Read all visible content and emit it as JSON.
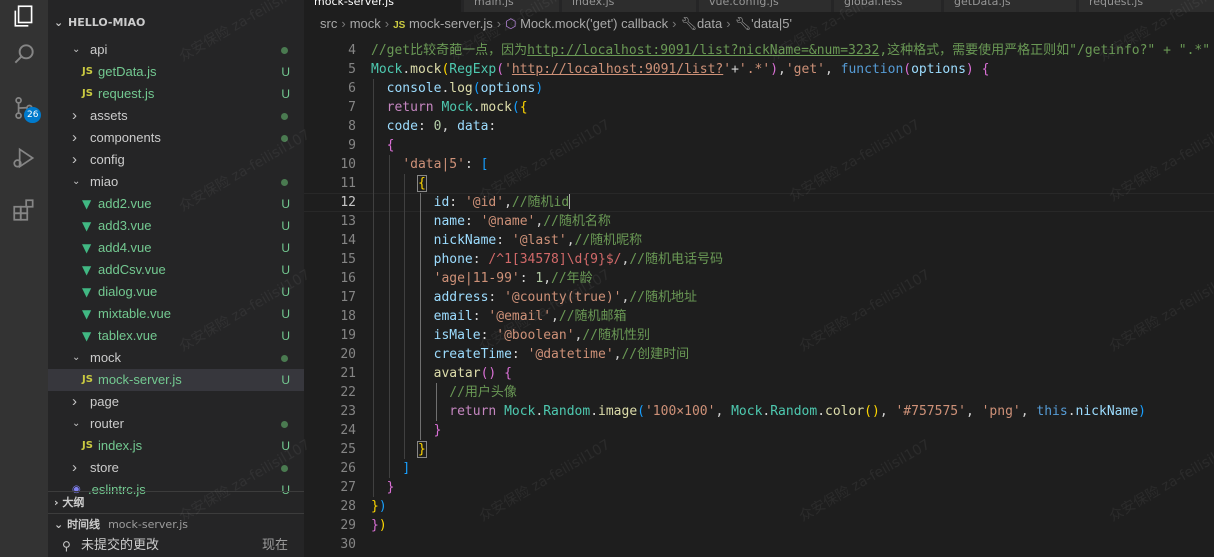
{
  "activity_bar": {
    "items": [
      {
        "icon": "explorer-icon"
      },
      {
        "icon": "search-icon"
      },
      {
        "icon": "source-control-icon",
        "badge": "26"
      },
      {
        "icon": "run-debug-icon"
      },
      {
        "icon": "extensions-icon"
      }
    ]
  },
  "explorer": {
    "title": "HELLO-MIAO",
    "tree": [
      {
        "label": "api",
        "type": "folder",
        "open": true,
        "depth": 1,
        "status": "dot"
      },
      {
        "label": "getData.js",
        "type": "js",
        "depth": 2,
        "status": "U"
      },
      {
        "label": "request.js",
        "type": "js",
        "depth": 2,
        "status": "U"
      },
      {
        "label": "assets",
        "type": "folder",
        "open": false,
        "depth": 1,
        "status": "dot"
      },
      {
        "label": "components",
        "type": "folder",
        "open": false,
        "depth": 1,
        "status": "dot"
      },
      {
        "label": "config",
        "type": "folder",
        "open": false,
        "depth": 1,
        "status": ""
      },
      {
        "label": "miao",
        "type": "folder",
        "open": true,
        "depth": 1,
        "status": "dot"
      },
      {
        "label": "add2.vue",
        "type": "vue",
        "depth": 2,
        "status": "U"
      },
      {
        "label": "add3.vue",
        "type": "vue",
        "depth": 2,
        "status": "U"
      },
      {
        "label": "add4.vue",
        "type": "vue",
        "depth": 2,
        "status": "U"
      },
      {
        "label": "addCsv.vue",
        "type": "vue",
        "depth": 2,
        "status": "U"
      },
      {
        "label": "dialog.vue",
        "type": "vue",
        "depth": 2,
        "status": "U"
      },
      {
        "label": "mixtable.vue",
        "type": "vue",
        "depth": 2,
        "status": "U"
      },
      {
        "label": "tablex.vue",
        "type": "vue",
        "depth": 2,
        "status": "U"
      },
      {
        "label": "mock",
        "type": "folder",
        "open": true,
        "depth": 1,
        "status": "dot"
      },
      {
        "label": "mock-server.js",
        "type": "js",
        "depth": 2,
        "status": "U",
        "selected": true
      },
      {
        "label": "page",
        "type": "folder",
        "open": false,
        "depth": 1,
        "status": ""
      },
      {
        "label": "router",
        "type": "folder",
        "open": true,
        "depth": 1,
        "status": "dot"
      },
      {
        "label": "index.js",
        "type": "js",
        "depth": 2,
        "status": "U"
      },
      {
        "label": "store",
        "type": "folder",
        "open": false,
        "depth": 1,
        "status": "dot"
      },
      {
        "label": ".eslintrc.js",
        "type": "eslint",
        "depth": 1,
        "status": "U"
      }
    ],
    "outline_title": "大纲",
    "timeline_title": "时间线",
    "timeline_file": "mock-server.js",
    "timeline_item": "未提交的更改",
    "timeline_time": "现在"
  },
  "tabs": [
    {
      "label": "mock-server.js",
      "active": true
    },
    {
      "label": "main.js",
      "active": false
    },
    {
      "label": "index.js",
      "active": false
    },
    {
      "label": "vue.config.js",
      "active": false
    },
    {
      "label": "global.less",
      "active": false
    },
    {
      "label": "getData.js",
      "active": false
    },
    {
      "label": "request.js",
      "active": false
    }
  ],
  "breadcrumb": {
    "parts": [
      "src",
      "mock",
      "mock-server.js",
      "Mock.mock('get') callback",
      "data",
      "'data|5'"
    ],
    "js_badge": "JS"
  },
  "editor": {
    "active_line": 12,
    "lines": [
      {
        "n": 4,
        "indent": 0,
        "tokens": [
          [
            "c-com",
            "//get比较奇葩一点，因为"
          ],
          [
            "c-com-u",
            "http://localhost:9091/list?nickName=&num=3232"
          ],
          [
            "c-com",
            ",这种格式，需要使用严格正则如\"/getinfo?\" + \".*\""
          ]
        ]
      },
      {
        "n": 5,
        "indent": 0,
        "tokens": [
          [
            "c-cls",
            "Mock"
          ],
          [
            "c-txt",
            "."
          ],
          [
            "c-fn",
            "mock"
          ],
          [
            "b1",
            "("
          ],
          [
            "c-cls",
            "RegExp"
          ],
          [
            "b2",
            "("
          ],
          [
            "c-str",
            "'"
          ],
          [
            "c-str-u",
            "http://localhost:9091/list?"
          ],
          [
            "c-str",
            "'"
          ],
          [
            "c-txt",
            "+"
          ],
          [
            "c-str",
            "'.*'"
          ],
          [
            "b2",
            ")"
          ],
          [
            "c-txt",
            ","
          ],
          [
            "c-str",
            "'get'"
          ],
          [
            "c-txt",
            ", "
          ],
          [
            "c-kwb",
            "function"
          ],
          [
            "b2",
            "("
          ],
          [
            "c-var",
            "options"
          ],
          [
            "b2",
            ")"
          ],
          [
            "c-txt",
            " "
          ],
          [
            "b2",
            "{"
          ]
        ]
      },
      {
        "n": 6,
        "indent": 1,
        "tokens": [
          [
            "c-var",
            "console"
          ],
          [
            "c-txt",
            "."
          ],
          [
            "c-fn",
            "log"
          ],
          [
            "b3",
            "("
          ],
          [
            "c-var",
            "options"
          ],
          [
            "b3",
            ")"
          ]
        ]
      },
      {
        "n": 7,
        "indent": 1,
        "tokens": [
          [
            "c-kw",
            "return"
          ],
          [
            "c-txt",
            " "
          ],
          [
            "c-cls",
            "Mock"
          ],
          [
            "c-txt",
            "."
          ],
          [
            "c-fn",
            "mock"
          ],
          [
            "b3",
            "("
          ],
          [
            "b1",
            "{"
          ]
        ]
      },
      {
        "n": 8,
        "indent": 1,
        "tokens": [
          [
            "c-var",
            "code"
          ],
          [
            "c-txt",
            ": "
          ],
          [
            "c-num",
            "0"
          ],
          [
            "c-txt",
            ", "
          ],
          [
            "c-var",
            "data"
          ],
          [
            "c-txt",
            ":"
          ]
        ]
      },
      {
        "n": 9,
        "indent": 1,
        "tokens": [
          [
            "b2",
            "{"
          ]
        ]
      },
      {
        "n": 10,
        "indent": 2,
        "tokens": [
          [
            "c-str",
            "'data|5'"
          ],
          [
            "c-txt",
            ": "
          ],
          [
            "b3",
            "["
          ]
        ]
      },
      {
        "n": 11,
        "indent": 3,
        "tokens": [
          [
            "b1 bhl",
            "{"
          ]
        ]
      },
      {
        "n": 12,
        "indent": 4,
        "tokens": [
          [
            "c-var",
            "id"
          ],
          [
            "c-txt",
            ": "
          ],
          [
            "c-str",
            "'@id'"
          ],
          [
            "c-txt",
            ","
          ],
          [
            "c-com",
            "//随机id"
          ]
        ],
        "caret": true
      },
      {
        "n": 13,
        "indent": 4,
        "tokens": [
          [
            "c-var",
            "name"
          ],
          [
            "c-txt",
            ": "
          ],
          [
            "c-str",
            "'@name'"
          ],
          [
            "c-txt",
            ","
          ],
          [
            "c-com",
            "//随机名称"
          ]
        ]
      },
      {
        "n": 14,
        "indent": 4,
        "tokens": [
          [
            "c-var",
            "nickName"
          ],
          [
            "c-txt",
            ": "
          ],
          [
            "c-str",
            "'@last'"
          ],
          [
            "c-txt",
            ","
          ],
          [
            "c-com",
            "//随机昵称"
          ]
        ]
      },
      {
        "n": 15,
        "indent": 4,
        "tokens": [
          [
            "c-var",
            "phone"
          ],
          [
            "c-txt",
            ": "
          ],
          [
            "c-re",
            "/^1[34578]\\d{9}$/"
          ],
          [
            "c-txt",
            ","
          ],
          [
            "c-com",
            "//随机电话号码"
          ]
        ]
      },
      {
        "n": 16,
        "indent": 4,
        "tokens": [
          [
            "c-str",
            "'age|11-99'"
          ],
          [
            "c-txt",
            ": "
          ],
          [
            "c-num",
            "1"
          ],
          [
            "c-txt",
            ","
          ],
          [
            "c-com",
            "//年龄"
          ]
        ]
      },
      {
        "n": 17,
        "indent": 4,
        "tokens": [
          [
            "c-var",
            "address"
          ],
          [
            "c-txt",
            ": "
          ],
          [
            "c-str",
            "'@county(true)'"
          ],
          [
            "c-txt",
            ","
          ],
          [
            "c-com",
            "//随机地址"
          ]
        ]
      },
      {
        "n": 18,
        "indent": 4,
        "tokens": [
          [
            "c-var",
            "email"
          ],
          [
            "c-txt",
            ": "
          ],
          [
            "c-str",
            "'@email'"
          ],
          [
            "c-txt",
            ","
          ],
          [
            "c-com",
            "//随机邮箱"
          ]
        ]
      },
      {
        "n": 19,
        "indent": 4,
        "tokens": [
          [
            "c-var",
            "isMale"
          ],
          [
            "c-txt",
            ": "
          ],
          [
            "c-str",
            "'@boolean'"
          ],
          [
            "c-txt",
            ","
          ],
          [
            "c-com",
            "//随机性别"
          ]
        ]
      },
      {
        "n": 20,
        "indent": 4,
        "tokens": [
          [
            "c-var",
            "createTime"
          ],
          [
            "c-txt",
            ": "
          ],
          [
            "c-str",
            "'@datetime'"
          ],
          [
            "c-txt",
            ","
          ],
          [
            "c-com",
            "//创建时间"
          ]
        ]
      },
      {
        "n": 21,
        "indent": 4,
        "tokens": [
          [
            "c-fn",
            "avatar"
          ],
          [
            "b2",
            "()"
          ],
          [
            "c-txt",
            " "
          ],
          [
            "b2",
            "{"
          ]
        ]
      },
      {
        "n": 22,
        "indent": 5,
        "tokens": [
          [
            "c-com",
            "//用户头像"
          ]
        ]
      },
      {
        "n": 23,
        "indent": 5,
        "tokens": [
          [
            "c-kw",
            "return"
          ],
          [
            "c-txt",
            " "
          ],
          [
            "c-cls",
            "Mock"
          ],
          [
            "c-txt",
            "."
          ],
          [
            "c-cls",
            "Random"
          ],
          [
            "c-txt",
            "."
          ],
          [
            "c-fn",
            "image"
          ],
          [
            "b3",
            "("
          ],
          [
            "c-str",
            "'100×100'"
          ],
          [
            "c-txt",
            ", "
          ],
          [
            "c-cls",
            "Mock"
          ],
          [
            "c-txt",
            "."
          ],
          [
            "c-cls",
            "Random"
          ],
          [
            "c-txt",
            "."
          ],
          [
            "c-fn",
            "color"
          ],
          [
            "b1",
            "()"
          ],
          [
            "c-txt",
            ", "
          ],
          [
            "c-str",
            "'#757575'"
          ],
          [
            "c-txt",
            ", "
          ],
          [
            "c-str",
            "'png'"
          ],
          [
            "c-txt",
            ", "
          ],
          [
            "c-kwb",
            "this"
          ],
          [
            "c-txt",
            "."
          ],
          [
            "c-var",
            "nickName"
          ],
          [
            "b3",
            ")"
          ]
        ]
      },
      {
        "n": 24,
        "indent": 4,
        "tokens": [
          [
            "b2",
            "}"
          ]
        ]
      },
      {
        "n": 25,
        "indent": 3,
        "tokens": [
          [
            "b1 bhl",
            "}"
          ]
        ]
      },
      {
        "n": 26,
        "indent": 2,
        "tokens": [
          [
            "b3",
            "]"
          ]
        ]
      },
      {
        "n": 27,
        "indent": 1,
        "tokens": [
          [
            "b2",
            "}"
          ]
        ]
      },
      {
        "n": 28,
        "indent": 0,
        "tokens": [
          [
            "b1",
            "}"
          ],
          [
            "b3",
            ")"
          ]
        ]
      },
      {
        "n": 29,
        "indent": 0,
        "tokens": [
          [
            "b2",
            "}"
          ],
          [
            "b1",
            ")"
          ]
        ]
      },
      {
        "n": 30,
        "indent": 0,
        "tokens": []
      }
    ]
  },
  "watermark": "众安保险 za-feilisil107"
}
